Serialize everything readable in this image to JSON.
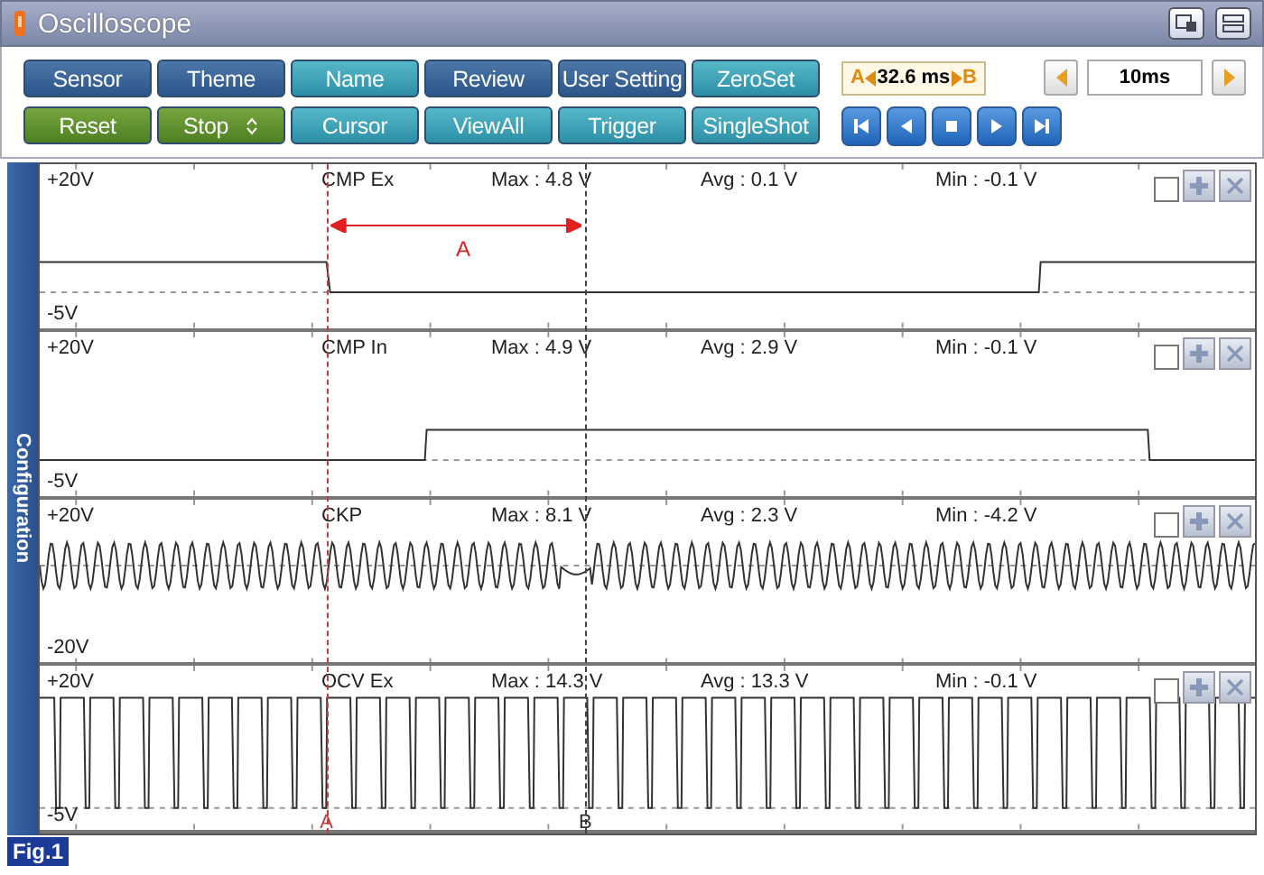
{
  "window": {
    "title": "Oscilloscope"
  },
  "toolbar": {
    "buttons": [
      {
        "label": "Sensor",
        "kind": "dark"
      },
      {
        "label": "Theme",
        "kind": "dark"
      },
      {
        "label": "Name",
        "kind": "teal"
      },
      {
        "label": "Review",
        "kind": "dark"
      },
      {
        "label": "User Setting",
        "kind": "dark"
      },
      {
        "label": "ZeroSet",
        "kind": "teal"
      },
      {
        "label": "Reset",
        "kind": "green"
      },
      {
        "label": "Stop",
        "kind": "spinner"
      },
      {
        "label": "Cursor",
        "kind": "teal"
      },
      {
        "label": "ViewAll",
        "kind": "teal"
      },
      {
        "label": "Trigger",
        "kind": "teal"
      },
      {
        "label": "SingleShot",
        "kind": "teal"
      }
    ],
    "cursor_readout": {
      "a": "A",
      "value": "32.6 ms",
      "b": "B"
    },
    "time_scale": "10ms"
  },
  "side_tab": "Configuration",
  "channels": [
    {
      "name": "CMP Ex",
      "top": "+20V",
      "bottom": "-5V",
      "max": "Max : 4.8 V",
      "avg": "Avg : 0.1 V",
      "min": "Min : -0.1 V",
      "kind": "step-down",
      "checked": false
    },
    {
      "name": "CMP In",
      "top": "+20V",
      "bottom": "-5V",
      "max": "Max : 4.9 V",
      "avg": "Avg : 2.9 V",
      "min": "Min : -0.1 V",
      "kind": "step-up",
      "checked": false
    },
    {
      "name": "CKP",
      "top": "+20V",
      "bottom": "-20V",
      "max": "Max : 8.1 V",
      "avg": "Avg : 2.3 V",
      "min": "Min : -4.2 V",
      "kind": "sine",
      "checked": false
    },
    {
      "name": "OCV Ex",
      "top": "+20V",
      "bottom": "-5V",
      "max": "Max : 14.3 V",
      "avg": "Avg : 13.3 V",
      "min": "Min : -0.1 V",
      "kind": "square",
      "checked": false
    }
  ],
  "cursors": {
    "a": "A",
    "b": "B",
    "span": "A"
  },
  "figure_label": "Fig.1"
}
